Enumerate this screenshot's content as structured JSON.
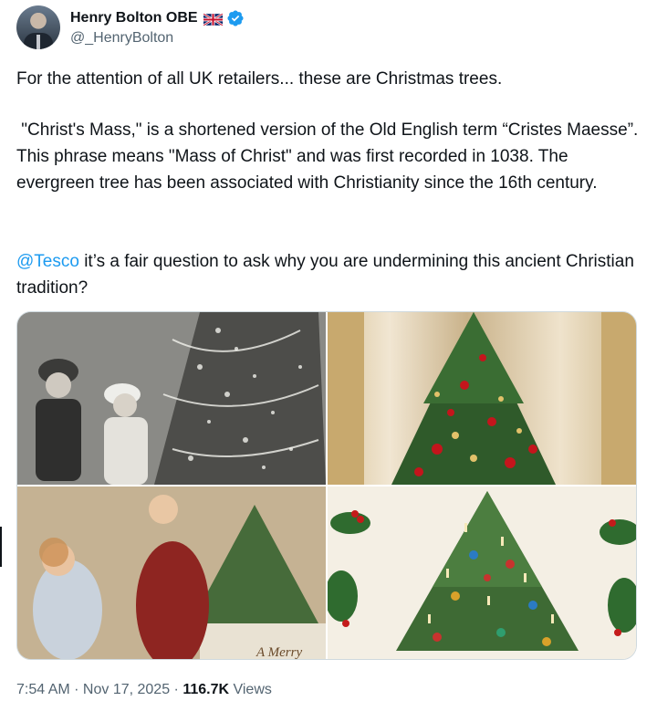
{
  "author": {
    "name": "Henry Bolton OBE",
    "handle": "@_HenryBolton",
    "flag_icon": "uk-flag-icon",
    "verified_icon": "verified-badge-icon",
    "verified_color": "#1d9bf0"
  },
  "tweet": {
    "line1": "For the attention of all UK retailers... these are Christmas trees.",
    "paragraph2": " \"Christ's Mass,\" is a shortened version of the Old English term “Cristes Maesse”. This phrase means \"Mass of Christ\" and was first recorded in 1038. The evergreen tree has been associated with Christianity since the 16th century.",
    "mention": "@Tesco",
    "paragraph3_rest": " it’s a fair question to ask why you are undermining this ancient Christian tradition?",
    "mention_color": "#1d9bf0"
  },
  "media": {
    "image3_caption": "A Merry"
  },
  "meta": {
    "time": "7:54 AM",
    "separator": " · ",
    "date": "Nov 17, 2025",
    "views_count": "116.7K",
    "views_label": " Views"
  }
}
